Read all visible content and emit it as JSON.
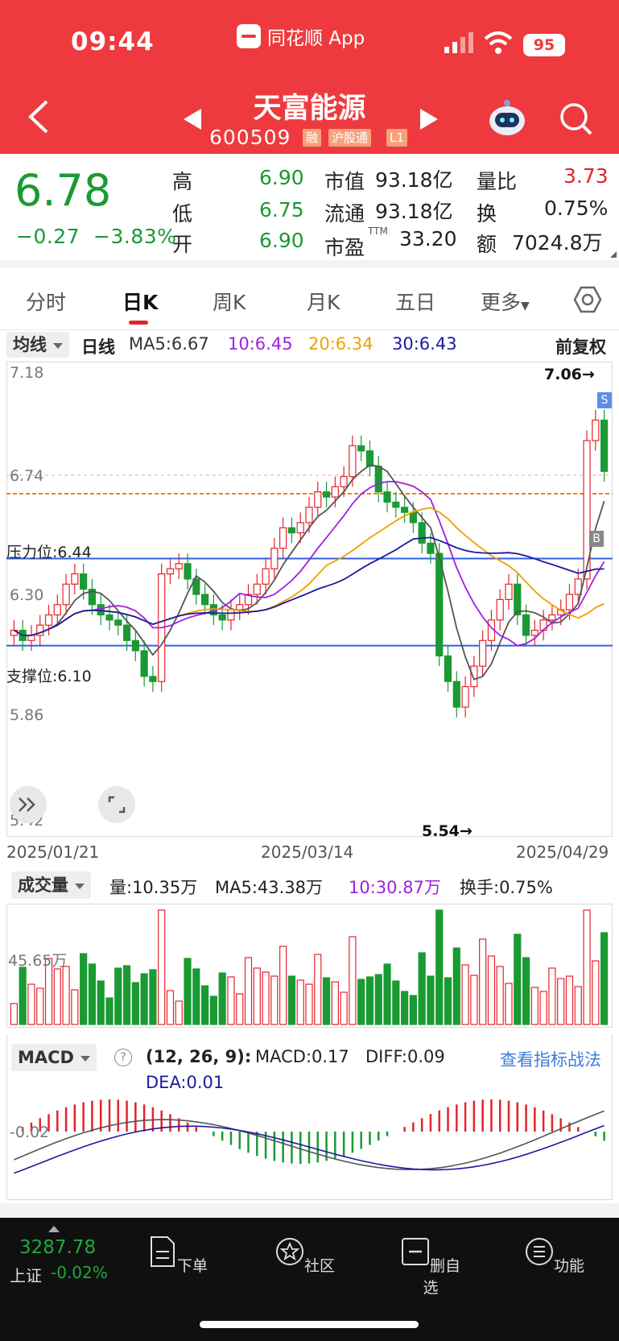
{
  "status": {
    "time": "09:44",
    "app": "同花顺 App",
    "battery": "95"
  },
  "header": {
    "title": "天富能源",
    "code": "600509",
    "tags": [
      "融",
      "沪股通",
      "L1"
    ]
  },
  "quote": {
    "price": "6.78",
    "change": "−0.27",
    "change_pct": "−3.83%",
    "high_label": "高",
    "high": "6.90",
    "low_label": "低",
    "low": "6.75",
    "open_label": "开",
    "open": "6.90",
    "mcap_label": "市值",
    "mcap": "93.18亿",
    "float_label": "流通",
    "float": "93.18亿",
    "pe_label": "市盈",
    "pe_sup": "TTM",
    "pe": "33.20",
    "vr_label": "量比",
    "vr": "3.73",
    "turn_label": "换",
    "turn": "0.75%",
    "amt_label": "额",
    "amt": "7024.8万"
  },
  "tabs": [
    "分时",
    "日K",
    "周K",
    "月K",
    "五日",
    "更多"
  ],
  "ma": {
    "selector": "均线",
    "period": "日线",
    "ma5": "MA5:6.67",
    "ma10": "10:6.45",
    "ma20": "20:6.34",
    "ma30": "30:6.43",
    "adj": "前复权"
  },
  "kchart": {
    "y_top": "7.18",
    "y2": "6.74",
    "y3": "6.30",
    "y4": "5.86",
    "y_bot": "5.42",
    "resist": "压力位:6.44",
    "support": "支撑位:6.10",
    "max": "7.06→",
    "min": "5.54→",
    "s": "S",
    "b": "B",
    "dates": [
      "2025/01/21",
      "2025/03/14",
      "2025/04/29"
    ]
  },
  "vol": {
    "selector": "成交量",
    "v": "量:10.35万",
    "ma5": "MA5:43.38万",
    "ma10": "10:30.87万",
    "turn": "换手:0.75%",
    "axis": "45.65万"
  },
  "macd": {
    "selector": "MACD",
    "help": "?",
    "params": "(12, 26, 9):",
    "macd": "MACD:0.17",
    "diff": "DIFF:0.09",
    "dea": "DEA:0.01",
    "link": "查看指标战法",
    "axis": "-0.02"
  },
  "bottom": {
    "index_val": "3287.78",
    "index_name": "上证",
    "index_chg": "-0.02%",
    "items": [
      "下单",
      "社区",
      "删自选",
      "功能"
    ]
  },
  "colors": {
    "up": "#e5232a",
    "down": "#1a9a32",
    "brand": "#ee3a3e"
  }
}
